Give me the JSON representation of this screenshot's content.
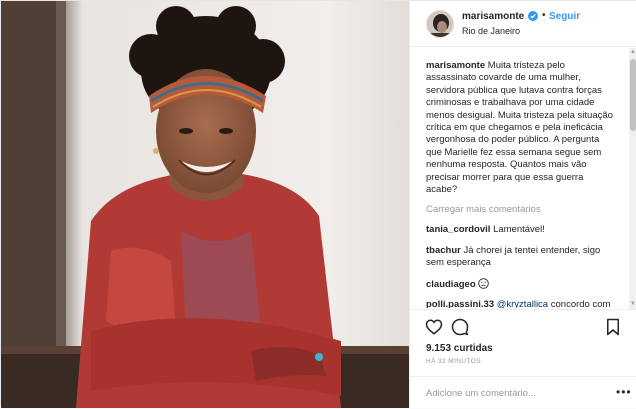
{
  "post": {
    "username": "marisamonte",
    "location": "Rio de Janeiro",
    "follow_label": "Seguir",
    "separator": "•",
    "photo_alt": "Photo of smiling woman with headband"
  },
  "caption": {
    "username": "marisamonte",
    "text": "Muita tristeza pelo assassinato covarde de uma mulher, servidora pública que lutava contra forças criminosas e trabalhava por uma cidade menos desigual. Muita tristeza pela situação crítica em que chegamos e pela ineficácia vergonhosa do poder público. A pergunta que Marielle fez essa semana segue sem nenhuma resposta. Quantos mais vão precisar morrer para que essa guerra acabe?"
  },
  "load_more_label": "Carregar mais comentários",
  "comments": [
    {
      "username": "tania_cordovil",
      "text": "Lamentável!"
    },
    {
      "username": "tbachur",
      "text": "Já chorei ja tentei entender, sigo sem esperança"
    },
    {
      "username": "claudiageo",
      "text": ""
    },
    {
      "username": "polli.passini.33",
      "mention": "@kryztallica",
      "text": "concordo com você!! Que delícia ler um texto bem escrito e consciente como o seu!!"
    }
  ],
  "stats": {
    "likes": "9.153 curtidas",
    "time": "HÁ 32 MINUTOS"
  },
  "add_comment": {
    "placeholder": "Adicione um comentário...",
    "more": "•••"
  },
  "icons": {
    "like": "heart-icon",
    "comment": "comment-icon",
    "save": "bookmark-icon",
    "verified": "verified-badge-icon",
    "emoji": "sad-face-emoji-icon"
  },
  "colors": {
    "link_blue": "#3897f0",
    "verified_blue": "#3897f0",
    "muted": "#999999",
    "text": "#262626"
  }
}
